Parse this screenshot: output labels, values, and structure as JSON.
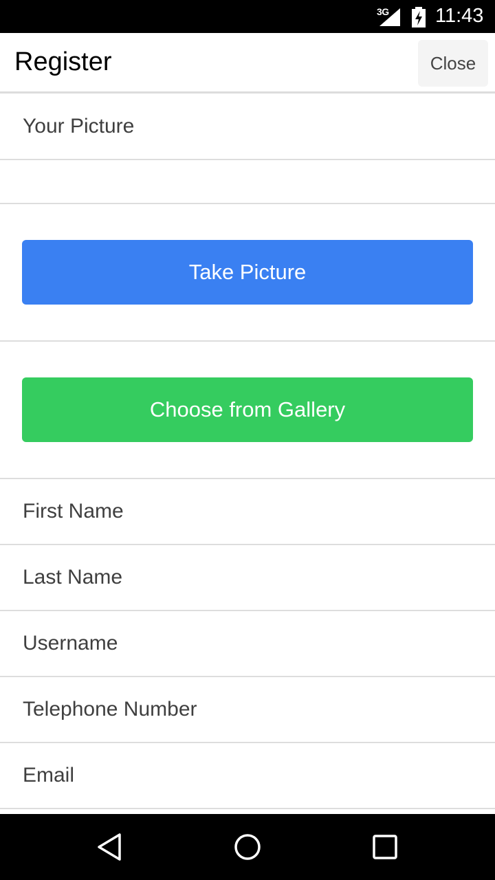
{
  "status_bar": {
    "network": "3G",
    "time": "11:43",
    "icons": [
      "signal-icon",
      "battery-charging-icon"
    ]
  },
  "header": {
    "title": "Register",
    "close_label": "Close"
  },
  "form": {
    "picture_label": "Your Picture",
    "take_picture_label": "Take Picture",
    "gallery_label": "Choose from Gallery",
    "fields": [
      {
        "label": "First Name"
      },
      {
        "label": "Last Name"
      },
      {
        "label": "Username"
      },
      {
        "label": "Telephone Number"
      },
      {
        "label": "Email"
      }
    ]
  },
  "colors": {
    "primary_button": "#3a80f2",
    "gallery_button": "#35cc5f"
  },
  "nav_bar": {
    "icons": [
      "back-icon",
      "home-icon",
      "recents-icon"
    ]
  }
}
